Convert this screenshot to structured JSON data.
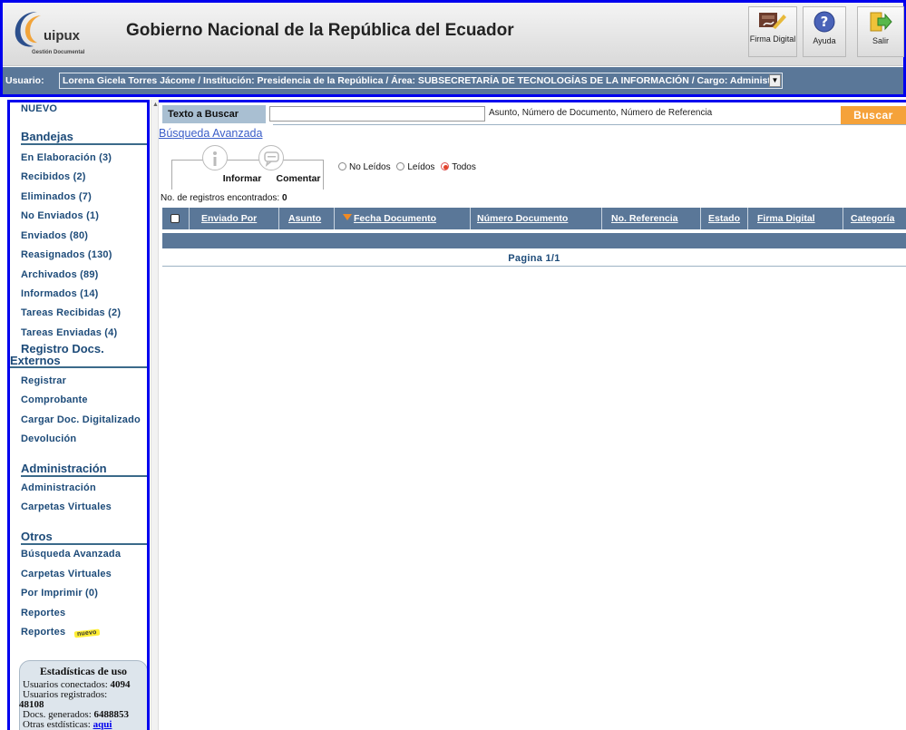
{
  "header": {
    "logo_name": "uipux",
    "logo_subtitle": "Gestión Documental",
    "title": "Gobierno Nacional de la República del Ecuador",
    "buttons": {
      "firma": "Firma Digital",
      "ayuda": "Ayuda",
      "salir": "Salir"
    }
  },
  "user_bar": {
    "label": "Usuario:",
    "selected": "Lorena Gicela Torres Jácome / Institución: Presidencia de la República / Área: SUBSECRETARÍA DE TECNOLOGÍAS DE LA INFORMACIÓN / Cargo: Administr"
  },
  "sidebar": {
    "nuevo": "NUEVO",
    "bandejas_title": "Bandejas",
    "bandejas": [
      "En Elaboración (3)",
      "Recibidos (2)",
      "Eliminados (7)",
      "No Enviados (1)",
      "Enviados (80)",
      "Reasignados (130)",
      "Archivados (89)",
      "Informados (14)",
      "Tareas Recibidas (2)",
      "Tareas Enviadas (4)"
    ],
    "registro_title_1": "Registro Docs.",
    "registro_title_2": "Externos",
    "registro": [
      "Registrar",
      "Comprobante",
      "Cargar Doc. Digitalizado",
      "Devolución"
    ],
    "admin_title": "Administración",
    "admin": [
      "Administración",
      "Carpetas Virtuales"
    ],
    "otros_title": "Otros",
    "otros": [
      "Búsqueda Avanzada",
      "Carpetas Virtuales",
      "Por Imprimir (0)",
      "Reportes",
      "Reportes"
    ],
    "nuevo_badge": "nuevo",
    "stats": {
      "title": "Estadísticas de uso",
      "conectados_label": "Usuarios conectados:",
      "conectados": "4094",
      "registrados_label": "Usuarios registrados:",
      "registrados": "48108",
      "generados_label": "Docs. generados:",
      "generados": "6488853",
      "otras_label": "Otras estdísticas:",
      "otras_link": "aqui"
    }
  },
  "main": {
    "search_label": "Texto a Buscar",
    "search_value": "",
    "search_hint": "Asunto, Número de Documento, Número de Referencia",
    "search_button": "Buscar",
    "advanced_link": "Búsqueda Avanzada",
    "actions": {
      "informar": "Informar",
      "comentar": "Comentar"
    },
    "filters": {
      "no_leidos": "No Leídos",
      "leidos": "Leídos",
      "todos": "Todos",
      "selected": "Todos"
    },
    "records_label": "No. de registros encontrados:",
    "records_count": "0",
    "columns": [
      "Enviado Por",
      "Asunto",
      "Fecha Documento",
      "Número Documento",
      "No. Referencia",
      "Estado",
      "Firma Digital",
      "Categoría"
    ],
    "pager": "Pagina 1/1"
  },
  "colors": {
    "accent": "#5a7798",
    "frame": "#0000ee",
    "buscar": "#f5a23a",
    "link": "#1d4b79"
  }
}
